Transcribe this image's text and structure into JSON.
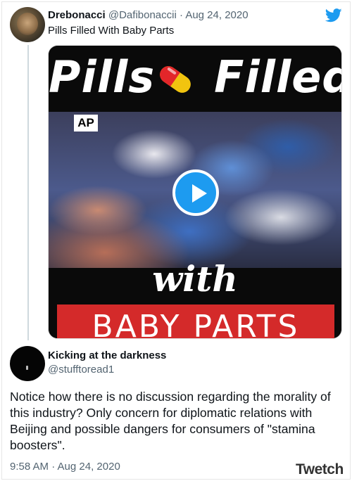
{
  "tweet1": {
    "display_name": "Drebonacci",
    "handle": "@Dafibonaccii",
    "separator": " · ",
    "date": "Aug 24, 2020",
    "text": "Pills Filled With Baby Parts",
    "media": {
      "title_word1": "Pills",
      "title_word2": "Filled",
      "source_badge": "AP",
      "with_text": "with",
      "banner_text": "BABY PARTS"
    }
  },
  "tweet2": {
    "display_name": "Kicking at the darkness",
    "handle": "@stufftoread1",
    "text": "Notice how there is no discussion regarding the morality of this industry? Only concern for diplomatic relations with Beijing and possible dangers for consumers of \"stamina boosters\".",
    "timestamp": "9:58 AM · Aug 24, 2020"
  },
  "watermark": "Twetch",
  "colors": {
    "accent": "#1d9bf0",
    "text_primary": "#0f1419",
    "text_secondary": "#536471",
    "banner_red": "#d42a2a"
  },
  "icons": {
    "brand": "twitter-bird-icon",
    "play": "play-icon",
    "pill": "pill-icon"
  }
}
